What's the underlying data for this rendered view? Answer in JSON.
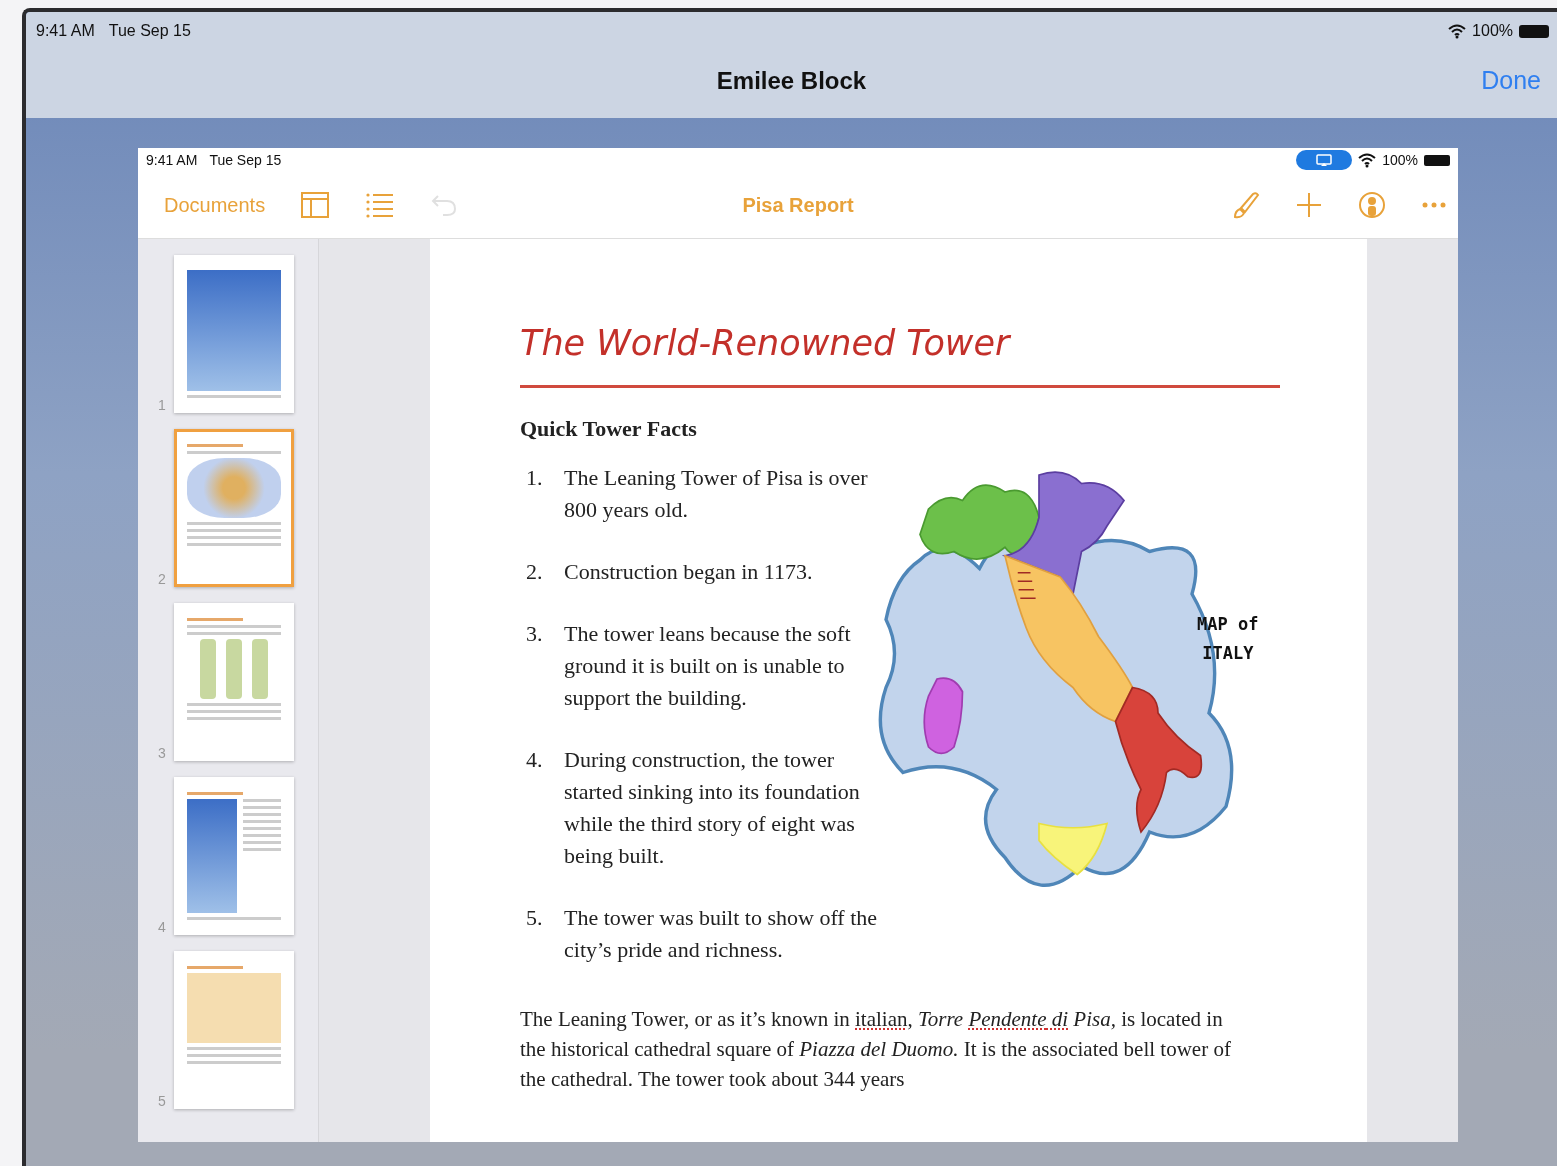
{
  "outer_status_bar": {
    "time": "9:41 AM",
    "date": "Tue Sep 15",
    "battery": "100%"
  },
  "nav_bar": {
    "title": "Emilee Block",
    "done": "Done"
  },
  "inner_status_bar": {
    "time": "9:41 AM",
    "date": "Tue Sep 15",
    "battery": "100%"
  },
  "toolbar": {
    "documents": "Documents",
    "title": "Pisa Report",
    "undo_disabled": true
  },
  "pages": [
    {
      "number": "1",
      "kind": "cover",
      "selected": false
    },
    {
      "number": "2",
      "kind": "map",
      "selected": true
    },
    {
      "number": "3",
      "kind": "diagrams",
      "selected": false
    },
    {
      "number": "4",
      "kind": "photo-text",
      "selected": false
    },
    {
      "number": "5",
      "kind": "illustration",
      "selected": false
    }
  ],
  "document": {
    "title": "The World-Renowned Tower",
    "heading": "Quick Tower Facts",
    "facts": [
      {
        "number": "1.",
        "text": "The Leaning Tower of Pisa is over 800 years old."
      },
      {
        "number": "2.",
        "text": " Construction began in 1173."
      },
      {
        "number": "3.",
        "text": "The tower leans because the soft ground it is built on is unable to support the building."
      },
      {
        "number": "4.",
        "text": "During construction, the tower started sinking into its foundation while the third story of eight was being built."
      },
      {
        "number": "5.",
        "text": "The tower was built to show off the city’s pride and richness."
      }
    ],
    "map_label": [
      "MAP of",
      "ITALY"
    ],
    "paragraph": [
      {
        "text": "The Leaning Tower, or as it’s known in ",
        "italic": false,
        "misspelled": false
      },
      {
        "text": "italian",
        "italic": false,
        "misspelled": true
      },
      {
        "text": ", ",
        "italic": false,
        "misspelled": false
      },
      {
        "text": "Torre ",
        "italic": true,
        "misspelled": false
      },
      {
        "text": "Pendente",
        "italic": true,
        "misspelled": true
      },
      {
        "text": " di",
        "italic": true,
        "misspelled": true
      },
      {
        "text": " Pisa,",
        "italic": true,
        "misspelled": false
      },
      {
        "text": " is located in the historical cathedral square of ",
        "italic": false,
        "misspelled": false
      },
      {
        "text": "Piazza del Duomo.",
        "italic": true,
        "misspelled": false
      },
      {
        "text": " It is the associated bell tower of the cathedral. The tower took about 344 years",
        "italic": false,
        "misspelled": false
      }
    ]
  }
}
